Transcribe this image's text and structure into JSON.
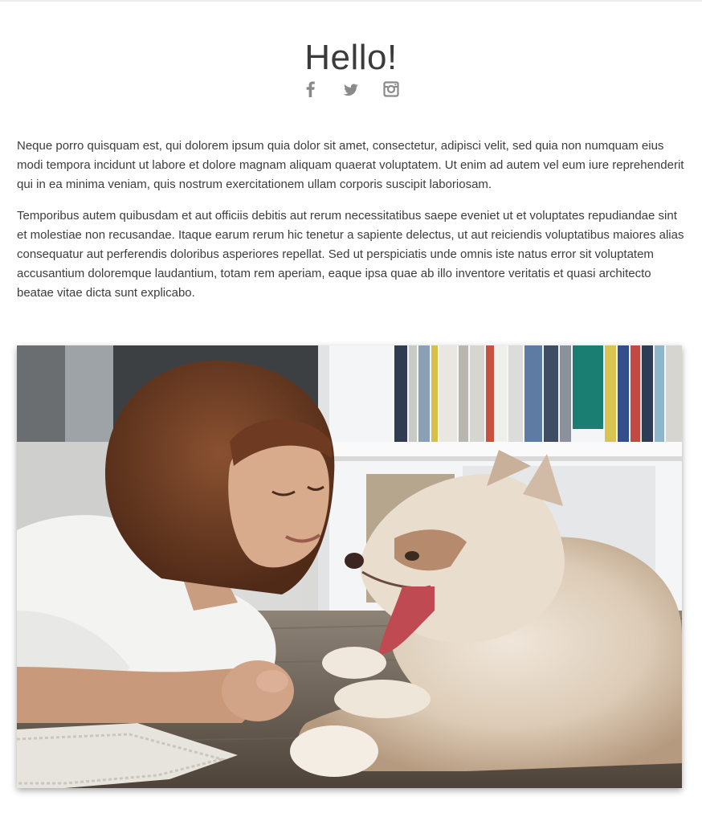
{
  "page": {
    "title": "Hello!"
  },
  "social": {
    "items": [
      {
        "name": "facebook",
        "icon": "facebook-icon"
      },
      {
        "name": "twitter",
        "icon": "twitter-icon"
      },
      {
        "name": "instagram",
        "icon": "instagram-icon"
      }
    ],
    "icon_color": "#8a8a8a"
  },
  "content": {
    "paragraph_1": "Neque porro quisquam est, qui dolorem ipsum quia dolor sit amet, consectetur, adipisci velit, sed quia non numquam eius modi tempora incidunt ut labore et dolore magnam aliquam quaerat voluptatem. Ut enim ad autem vel eum iure reprehenderit qui in ea minima veniam, quis nostrum exercitationem ullam corporis suscipit laboriosam.",
    "paragraph_2": "Temporibus autem quibusdam et aut officiis debitis aut rerum necessitatibus saepe eveniet ut et voluptates repudiandae sint et molestiae non recusandae. Itaque earum rerum hic tenetur a sapiente delectus, ut aut reiciendis voluptatibus maiores alias consequatur aut perferendis doloribus asperiores repellat. Sed ut perspiciatis unde omnis iste natus error sit voluptatem accusantium doloremque laudantium, totam rem aperiam, eaque ipsa quae ab illo inventore veritatis et quasi architecto beatae vitae dicta sunt explicabo."
  },
  "photo": {
    "subject": "woman-and-husky-puppy-photo"
  }
}
